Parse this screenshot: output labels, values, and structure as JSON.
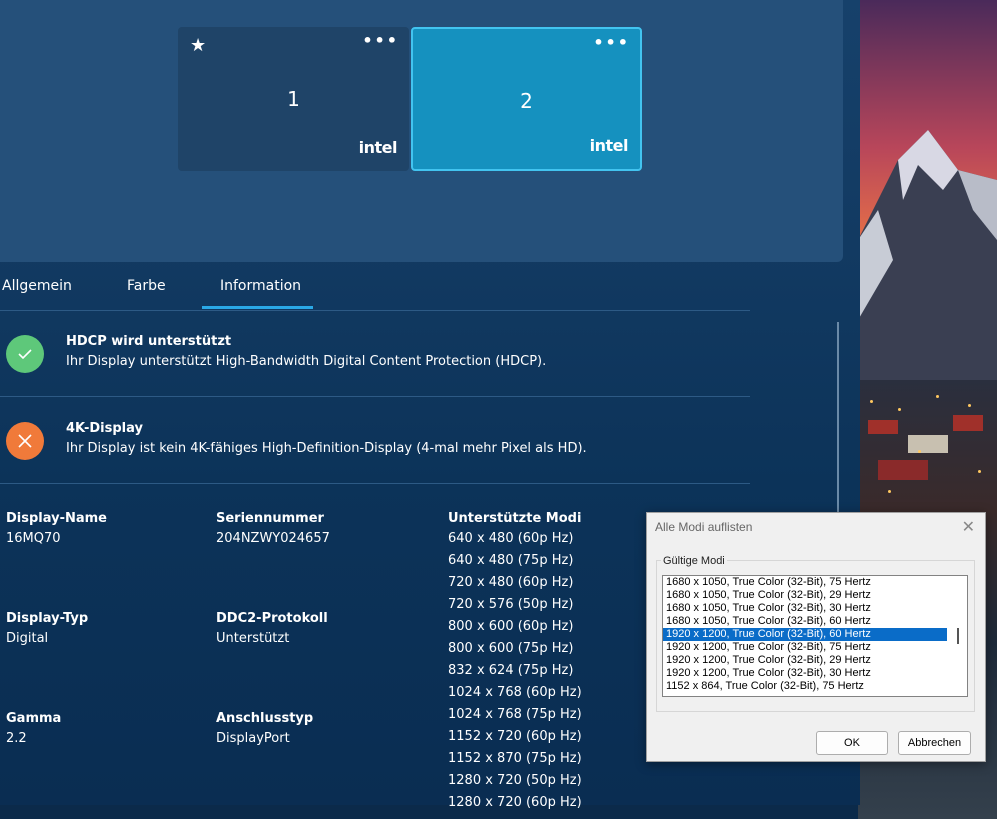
{
  "monitors": [
    {
      "number": "1",
      "brand": "intel",
      "menu": "•••",
      "star": "★"
    },
    {
      "number": "2",
      "brand": "intel",
      "menu": "•••"
    }
  ],
  "tabs": [
    {
      "label": "Allgemein"
    },
    {
      "label": "Farbe"
    },
    {
      "label": "Information"
    }
  ],
  "active_tab": "Information",
  "features": [
    {
      "title": "HDCP wird unterstützt",
      "desc": "Ihr Display unterstützt High-Bandwidth Digital Content Protection (HDCP).",
      "status": "supported",
      "icon": "check-icon",
      "color": "#5ec87a"
    },
    {
      "title": "4K-Display",
      "desc": "Ihr Display ist kein 4K-fähiges High-Definition-Display (4-mal mehr Pixel als HD).",
      "status": "not-supported",
      "icon": "cross-icon",
      "color": "#f07a3a"
    }
  ],
  "info": {
    "display_name_label": "Display-Name",
    "display_name": "16MQ70",
    "serial_label": "Seriennummer",
    "serial": "204NZWY024657",
    "display_type_label": "Display-Typ",
    "display_type": "Digital",
    "ddc2_label": "DDC2-Protokoll",
    "ddc2": "Unterstützt",
    "gamma_label": "Gamma",
    "gamma": "2.2",
    "connection_label": "Anschlusstyp",
    "connection": "DisplayPort",
    "modes_label": "Unterstützte Modi",
    "modes": [
      "640 x 480 (60p Hz)",
      "640 x 480 (75p Hz)",
      "720 x 480 (60p Hz)",
      "720 x 576 (50p Hz)",
      "800 x 600 (60p Hz)",
      "800 x 600 (75p Hz)",
      "832 x 624 (75p Hz)",
      "1024 x 768 (60p Hz)",
      "1024 x 768 (75p Hz)",
      "1152 x 720 (60p Hz)",
      "1152 x 870 (75p Hz)",
      "1280 x 720 (50p Hz)",
      "1280 x 720 (60p Hz)"
    ]
  },
  "dialog": {
    "title": "Alle Modi auflisten",
    "close": "✕",
    "group_label": "Gültige Modi",
    "items": [
      "1680 x 1050, True Color (32-Bit), 75 Hertz",
      "1680 x 1050, True Color (32-Bit), 29 Hertz",
      "1680 x 1050, True Color (32-Bit), 30 Hertz",
      "1680 x 1050, True Color (32-Bit), 60 Hertz",
      "1920 x 1200, True Color (32-Bit), 60 Hertz",
      "1920 x 1200, True Color (32-Bit), 75 Hertz",
      "1920 x 1200, True Color (32-Bit), 29 Hertz",
      "1920 x 1200, True Color (32-Bit), 30 Hertz",
      "1152 x 864, True Color (32-Bit), 75 Hertz"
    ],
    "selected_index": 4,
    "ok_label": "OK",
    "cancel_label": "Abbrechen"
  }
}
